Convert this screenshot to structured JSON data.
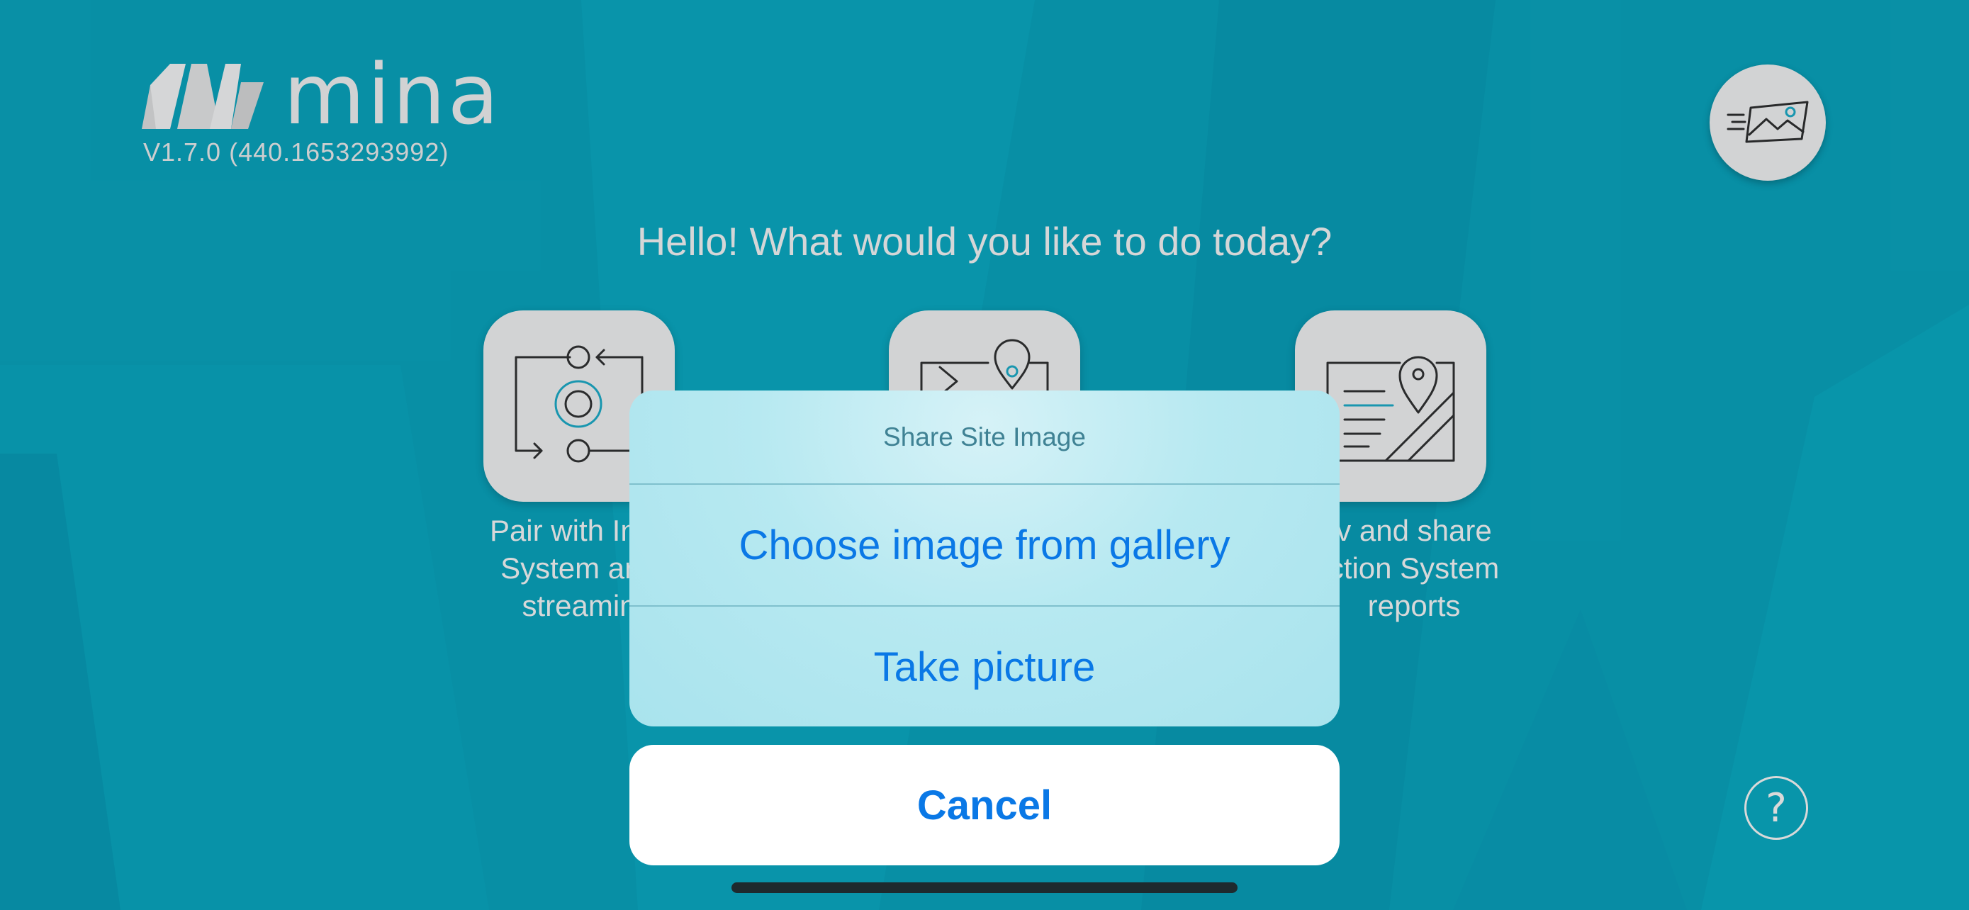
{
  "app": {
    "name": "mina",
    "version": "V1.7.0 (440.1653293992)",
    "logo_icon": "mina-logo-icon"
  },
  "header": {
    "share_button_icon": "share-image-icon"
  },
  "greeting": "Hello! What would you like to do today?",
  "cards": [
    {
      "icon": "pair-stream-icon",
      "label_lines": [
        "Pair with Insp",
        "System and",
        "streamin"
      ]
    },
    {
      "icon": "site-image-icon",
      "label_lines": []
    },
    {
      "icon": "reports-icon",
      "label_lines": [
        "v and share",
        "ction System",
        "reports"
      ]
    }
  ],
  "action_sheet": {
    "title": "Share Site Image",
    "actions": [
      "Choose image from gallery",
      "Take picture"
    ],
    "cancel_label": "Cancel"
  },
  "help_button": {
    "glyph": "?",
    "icon": "help-icon"
  },
  "colors": {
    "background": "#0993a9",
    "accent": "#0a78e6",
    "sheet": "#b7e9f1"
  }
}
